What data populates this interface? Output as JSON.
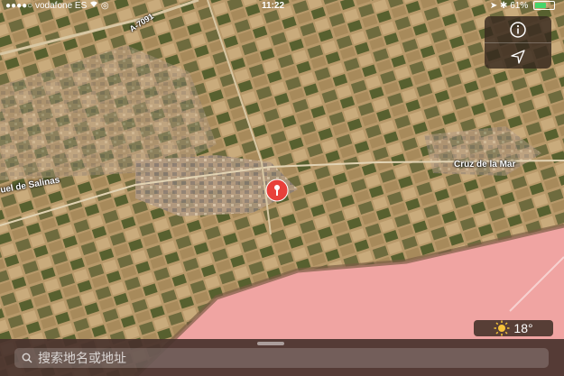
{
  "status_bar": {
    "signal": "●●●●○",
    "carrier": "vodafone ES",
    "time": "11:22",
    "battery_percent": "61%",
    "battery_level": 0.61,
    "battery_color": "#46d46a"
  },
  "map": {
    "labels": {
      "road": "A-7091",
      "place_1": "uel de Salinas",
      "place_2": "Cruz de la Mar"
    },
    "lake_color": "#f0a4a2",
    "pin_color": "#e8403a"
  },
  "weather": {
    "icon": "sun-icon",
    "temperature": "18°"
  },
  "search": {
    "placeholder": "搜索地名或地址"
  }
}
